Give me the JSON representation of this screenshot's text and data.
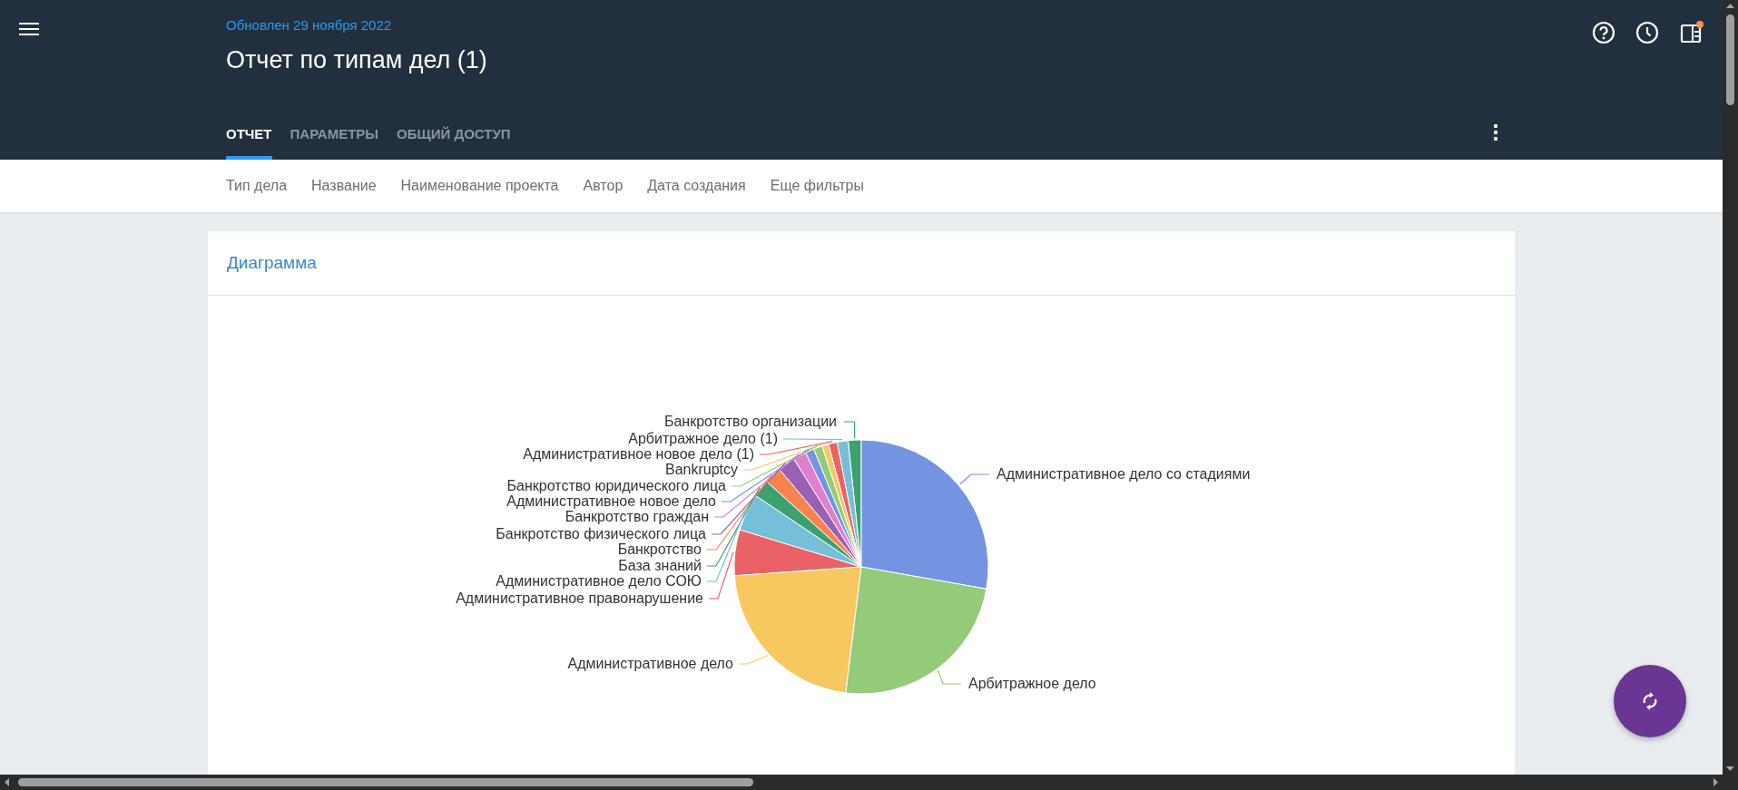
{
  "header": {
    "updated": "Обновлен 29 ноября 2022",
    "title": "Отчет по типам дел (1)",
    "notification_dot": true,
    "tabs": [
      {
        "label": "ОТЧЕТ",
        "selected": true
      },
      {
        "label": "ПАРАМЕТРЫ",
        "selected": false
      },
      {
        "label": "ОБЩИЙ ДОСТУП",
        "selected": false
      }
    ]
  },
  "filters": [
    "Тип дела",
    "Название",
    "Наименование проекта",
    "Автор",
    "Дата создания",
    "Еще фильтры"
  ],
  "card": {
    "title": "Диаграмма",
    "pie_slices": [
      {
        "label": "Банкротство организации",
        "color": "#3ca06f"
      },
      {
        "label": "Арбитражное дело (1)",
        "color": "#75bfd9"
      },
      {
        "label": "Административное новое дело (1)",
        "color": "#ea6266"
      },
      {
        "label": "Bankruptcy",
        "color": "#f7c85f"
      },
      {
        "label": "Административное дело со стадиями",
        "color": "#7494e2"
      },
      {
        "label": "Банкротство юридического лица",
        "color": "#93cb78"
      },
      {
        "label": "Административное новое дело",
        "color": "#7494e2"
      },
      {
        "label": "Банкротство граждан",
        "color": "#e17fcf"
      },
      {
        "label": "Банкротство физического лица",
        "color": "#9960b4"
      },
      {
        "label": "Банкротство",
        "color": "#f8834f"
      },
      {
        "label": "База знаний",
        "color": "#3ca06f"
      },
      {
        "label": "Административное дело СОЮ",
        "color": "#75bfd9"
      },
      {
        "label": "Административное правонарушение",
        "color": "#ea6266"
      },
      {
        "label": "Административное дело",
        "color": "#f7c85f"
      },
      {
        "label": "Арбитражное дело",
        "color": "#93cb78"
      }
    ]
  }
}
